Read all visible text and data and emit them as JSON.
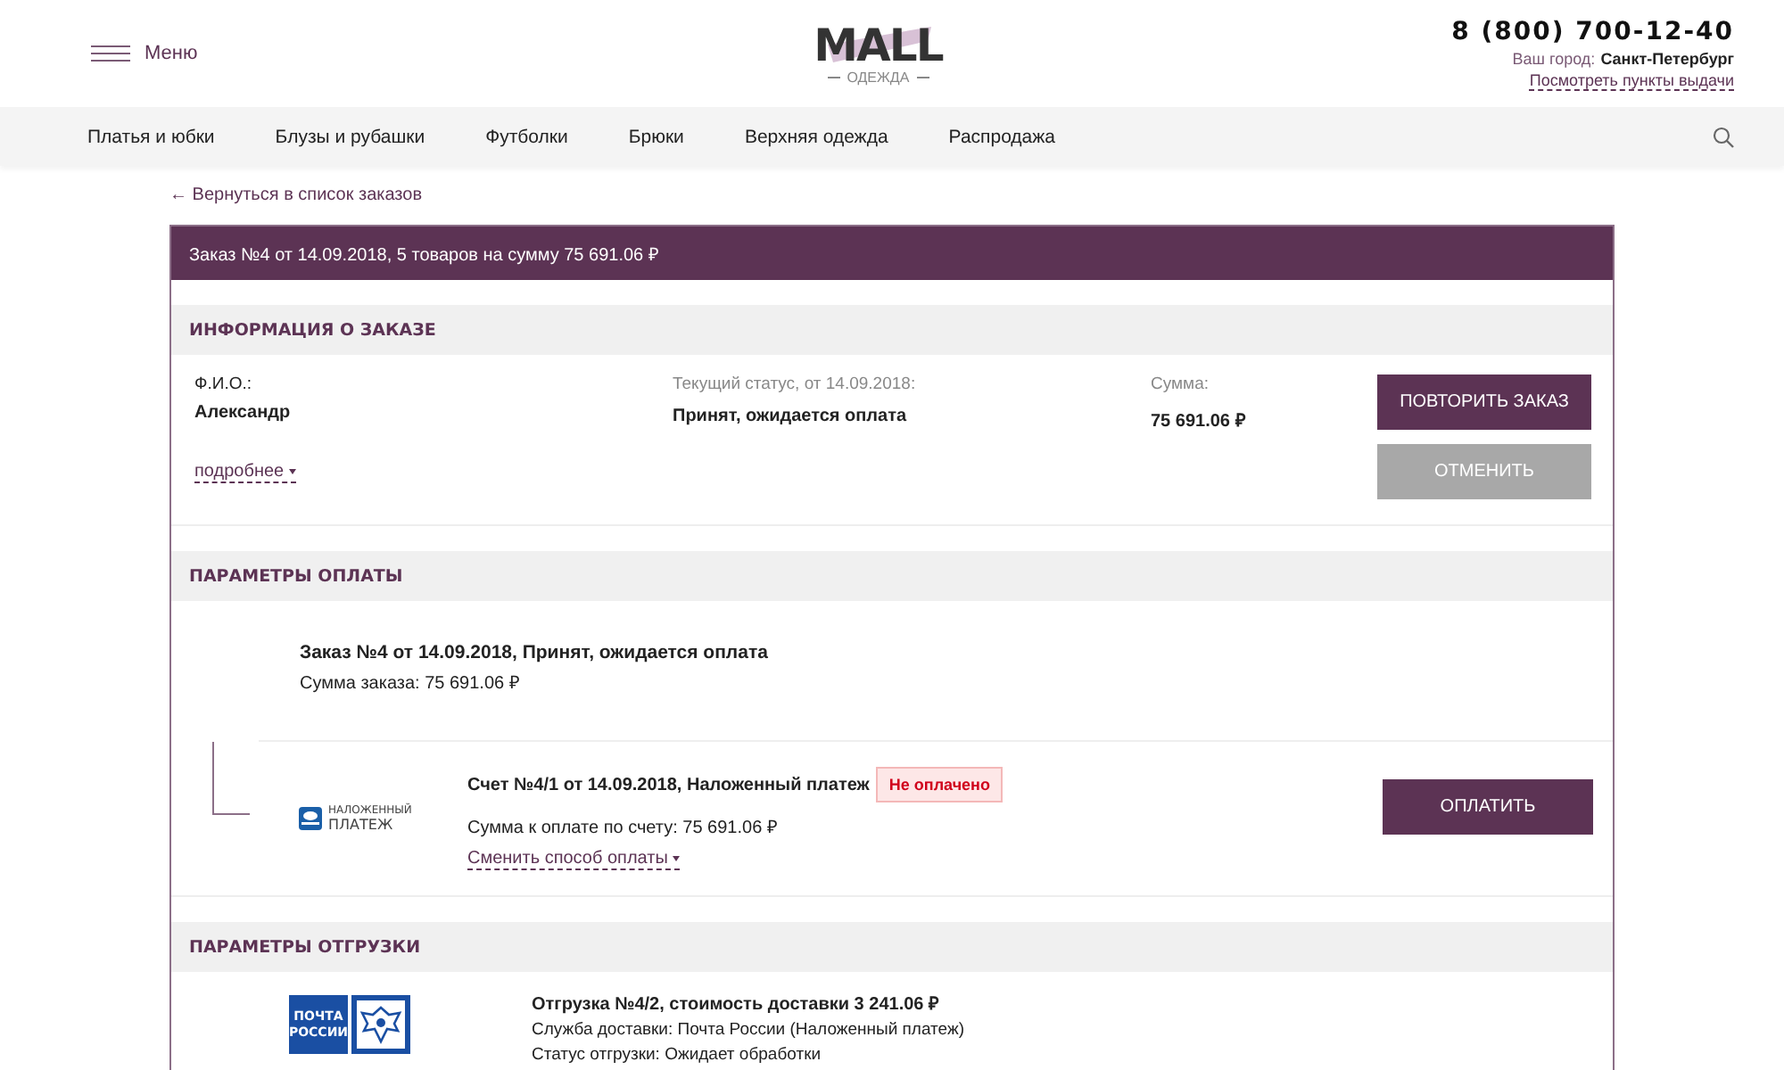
{
  "header": {
    "menu_label": "Меню",
    "logo": {
      "title": "MALL",
      "subtitle": "ОДЕЖДА"
    },
    "phone": "8 (800) 700-12-40",
    "city_label": "Ваш город:",
    "city": "Санкт-Петербург",
    "pickup_link": "Посмотреть пункты выдачи"
  },
  "nav": {
    "items": [
      "Платья и юбки",
      "Блузы и рубашки",
      "Футболки",
      "Брюки",
      "Верхняя одежда",
      "Распродажа"
    ]
  },
  "back_link": "← Вернуться в список заказов",
  "order": {
    "title": "Заказ №4 от 14.09.2018, 5 товаров на сумму 75 691.06 ₽",
    "info": {
      "heading": "ИНФОРМАЦИЯ О ЗАКАЗЕ",
      "name_label": "Ф.И.О.:",
      "name": "Александр",
      "more_link": "подробнее",
      "status_label": "Текущий статус, от 14.09.2018:",
      "status": "Принят, ожидается оплата",
      "sum_label": "Сумма:",
      "sum": "75 691.06 ₽",
      "buttons": [
        {
          "label": "ПОВТОРИТЬ ЗАКАЗ",
          "disabled": false
        },
        {
          "label": "ОТМЕНИТЬ",
          "disabled": true
        }
      ]
    },
    "payment": {
      "heading": "ПАРАМЕТРЫ ОПЛАТЫ",
      "summary_title": "Заказ №4 от 14.09.2018, Принят, ожидается оплата",
      "summary_sum": "Сумма заказа: 75 691.06 ₽",
      "invoices": [
        {
          "logo_lines": [
            "НАЛОЖЕННЫЙ",
            "ПЛАТЕЖ"
          ],
          "title": "Счет №4/1 от 14.09.2018, Наложенный платеж",
          "paid": false,
          "status": "Не оплачено",
          "amount": "Сумма к оплате по счету: 75 691.06 ₽",
          "change_link": "Сменить способ оплаты",
          "pay_button": "ОПЛАТИТЬ"
        }
      ]
    },
    "shipping": {
      "heading": "ПАРАМЕТРЫ ОТГРУЗКИ",
      "shipments": [
        {
          "logo_lines": [
            "ПОЧТА",
            "РОССИИ"
          ],
          "title": "Отгрузка №4/2, стоимость доставки 3 241.06 ₽",
          "service": "Служба доставки: Почта России (Наложенный платеж)",
          "status": "Статус отгрузки: Ожидает обработки"
        }
      ]
    }
  }
}
